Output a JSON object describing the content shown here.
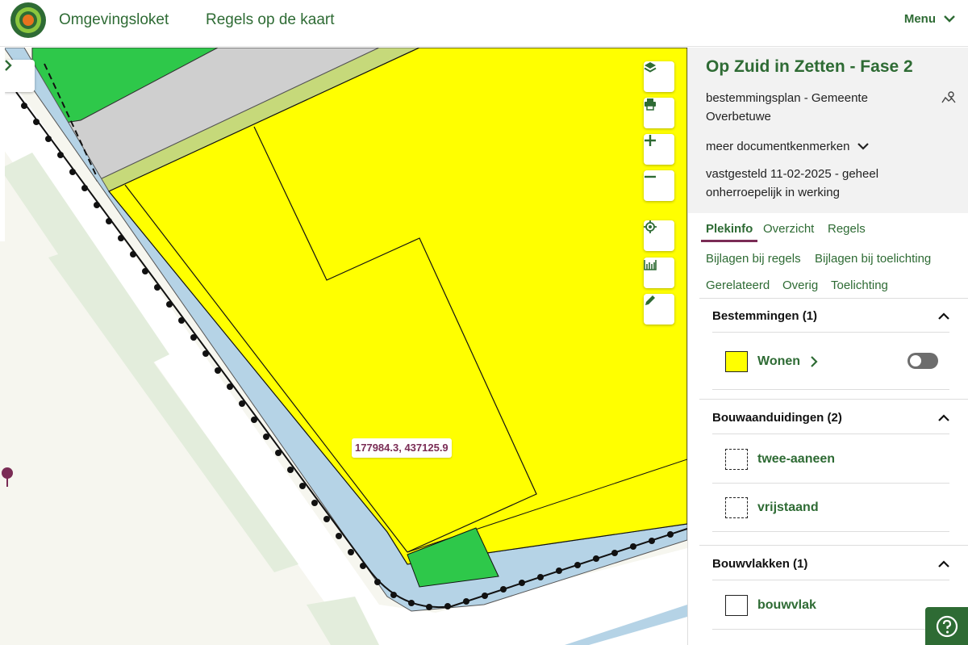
{
  "header": {
    "app_name": "Omgevingsloket",
    "page_name": "Regels op de kaart",
    "menu_label": "Menu"
  },
  "map": {
    "coordinate": "177984.3, 437125.9"
  },
  "document": {
    "title": "Op Zuid in Zetten - Fase 2",
    "type_line1": "bestemmingsplan - Gemeente",
    "type_line2": "Overbetuwe",
    "meer_label": "meer documentkenmerken",
    "status_line1": "vastgesteld 11-02-2025 - geheel",
    "status_line2": "onherroepelijk in werking"
  },
  "tabs": [
    {
      "label": "Plekinfo",
      "active": true
    },
    {
      "label": "Overzicht"
    },
    {
      "label": "Regels"
    },
    {
      "label": "Bijlagen bij regels"
    },
    {
      "label": "Bijlagen bij toelichting"
    },
    {
      "label": "Gerelateerd"
    },
    {
      "label": "Overig"
    },
    {
      "label": "Toelichting"
    }
  ],
  "sections": [
    {
      "title": "Bestemmingen (1)",
      "items": [
        {
          "label": "Wonen"
        }
      ]
    },
    {
      "title": "Bouwaanduidingen (2)",
      "items": [
        {
          "label": "twee-aaneen"
        },
        {
          "label": "vrijstaand"
        }
      ]
    },
    {
      "title": "Bouwvlakken (1)",
      "items": [
        {
          "label": "bouwvlak"
        }
      ]
    }
  ],
  "colors": {
    "brand_green": "#2e6b34",
    "plot_yellow": "#ffff00",
    "green_area": "#2ec84a",
    "water_blue": "#b5d3e6",
    "accent_purple": "#7a2c55"
  }
}
